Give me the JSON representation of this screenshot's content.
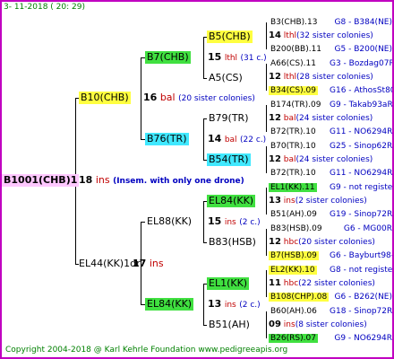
{
  "header": "3-  11-2018 (  20:  29)",
  "footer": "Copyright 2004-2018 @ Karl Kehrle Foundation    www.pedigreeapis.org",
  "root": {
    "name": "B1001(CHB)1",
    "num": "18",
    "ins": "ins",
    "note": "(Insem. with only one drone)"
  },
  "g1": [
    {
      "name": "B10(CHB)",
      "num": "16",
      "ins": "bal",
      "note": "(20 sister colonies)"
    },
    {
      "name": "EL44(KK)1dr",
      "num": "17",
      "ins": "ins",
      "note": ""
    }
  ],
  "g2": [
    {
      "name": "B7(CHB)",
      "num": "15",
      "ins": "lthl",
      "note": "(31 c.)"
    },
    {
      "name": "B76(TR)",
      "num": "14",
      "ins": "bal",
      "note": "(22 c.)"
    },
    {
      "name": "EL88(KK)",
      "num": "15",
      "ins": "ins",
      "note": "(2 c.)"
    },
    {
      "name": "EL84(KK)",
      "num": "13",
      "ins": "ins",
      "note": "(2 c.)"
    }
  ],
  "g3": [
    "B5(CHB)",
    "A5(CS)",
    "B79(TR)",
    "B54(TR)",
    "EL84(KK)",
    "B83(HSB)",
    "EL1(KK)",
    "B51(AH)"
  ],
  "rows": [
    {
      "left": "B3(CHB).13",
      "right": "G8 - B384(NE)"
    },
    {
      "num": "14",
      "ins": "lthl",
      "note": "(32 sister colonies)"
    },
    {
      "left": "B200(BB).11",
      "right": "G5 - B200(NE)"
    },
    {
      "left": "A66(CS).11",
      "right": "G3 - Bozdag07R"
    },
    {
      "num": "12",
      "ins": "lthl",
      "note": "(28 sister colonies)"
    },
    {
      "left": "B34(CS).09",
      "right": "G16 - AthosSt80R"
    },
    {
      "left": "B174(TR).09",
      "right": "G9 - Takab93aR"
    },
    {
      "num": "12",
      "ins": "bal",
      "note": "(24 sister colonies)"
    },
    {
      "left": "B72(TR).10",
      "right": "G11 - NO6294R"
    },
    {
      "left": "B70(TR).10",
      "right": "G25 - Sinop62R"
    },
    {
      "num": "12",
      "ins": "bal",
      "note": "(24 sister colonies)"
    },
    {
      "left": "B72(TR).10",
      "right": "G11 - NO6294R"
    },
    {
      "left": "EL1(KK).11",
      "right": "G9 - not registe"
    },
    {
      "num": "13",
      "ins": "ins",
      "note": "(2 sister colonies)"
    },
    {
      "left": "B51(AH).09",
      "right": "G19 - Sinop72R"
    },
    {
      "left": "B83(HSB).09",
      "right": "G6 - MG00R"
    },
    {
      "num": "12",
      "ins": "hbc",
      "note": "(20 sister colonies)"
    },
    {
      "left": "B7(HSB).09",
      "right": "G6 - Bayburt98-3"
    },
    {
      "left": "EL2(KK).10",
      "right": "G8 - not registe"
    },
    {
      "num": "11",
      "ins": "hbc",
      "note": "(22 sister colonies)"
    },
    {
      "left": "B108(CHP).08",
      "right": "G6 - B262(NE)"
    },
    {
      "left": "B60(AH).06",
      "right": "G18 - Sinop72R"
    },
    {
      "num": "09",
      "ins": "ins",
      "note": "(8 sister colonies)"
    },
    {
      "left": "B26(RS).07",
      "right": "G9 - NO6294R"
    }
  ]
}
